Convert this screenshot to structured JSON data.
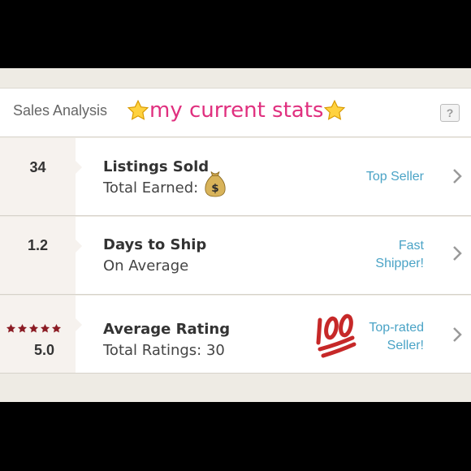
{
  "header": {
    "title": "Sales Analysis",
    "banner_text": "my current stats",
    "help_label": "?"
  },
  "rows": [
    {
      "value": "34",
      "title": "Listings Sold",
      "subtitle": "Total Earned:",
      "subtitle_icon": "money-bag-icon",
      "badge": [
        "Top Seller"
      ],
      "chevron_icon": "chevron-right-icon"
    },
    {
      "value": "1.2",
      "title": "Days to Ship",
      "subtitle": "On Average",
      "badge": [
        "Fast",
        "Shipper!"
      ],
      "chevron_icon": "chevron-right-icon"
    },
    {
      "value": "5.0",
      "rating_stars": 5,
      "title": "Average Rating",
      "subtitle": "Total Ratings: 30",
      "decoration_icon": "hundred-points-icon",
      "badge": [
        "Top-rated",
        "Seller!"
      ],
      "chevron_icon": "chevron-right-icon"
    }
  ],
  "colors": {
    "banner": "#e0307f",
    "badge": "#4aa3c6",
    "rating_star": "#8b1c24"
  }
}
